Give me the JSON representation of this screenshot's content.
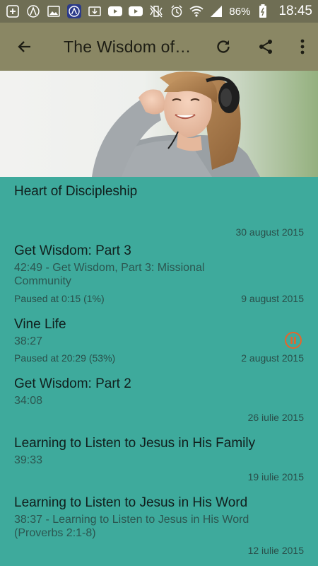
{
  "status_bar": {
    "battery": "86%",
    "time": "18:45"
  },
  "toolbar": {
    "title": "The Wisdom of God"
  },
  "episodes": [
    {
      "title": "Heart of Discipleship",
      "subtitle": "",
      "progress": "",
      "date": "30 august 2015"
    },
    {
      "title": "Get Wisdom: Part 3",
      "subtitle": "42:49 - Get Wisdom, Part 3: Missional Community",
      "progress": "Paused at 0:15 (1%)",
      "date": "9 august 2015"
    },
    {
      "title": "Vine Life",
      "subtitle": "38:27",
      "progress": "Paused at 20:29 (53%)",
      "date": "2 august 2015"
    },
    {
      "title": "Get Wisdom: Part 2",
      "subtitle": "34:08",
      "progress": "",
      "date": "26 iulie 2015"
    },
    {
      "title": "Learning to Listen to Jesus in His Family",
      "subtitle": "39:33",
      "progress": "",
      "date": "19 iulie 2015"
    },
    {
      "title": "Learning to Listen to Jesus in His Word",
      "subtitle": "38:37 - Learning to Listen to Jesus in His Word (Proverbs 2:1-8)",
      "progress": "",
      "date": "12 iulie 2015"
    }
  ],
  "colors": {
    "accent": "#3eaa9c",
    "toolbar": "#8a8764",
    "status_bar": "#6f6e54",
    "pause_icon": "#e8642a"
  }
}
